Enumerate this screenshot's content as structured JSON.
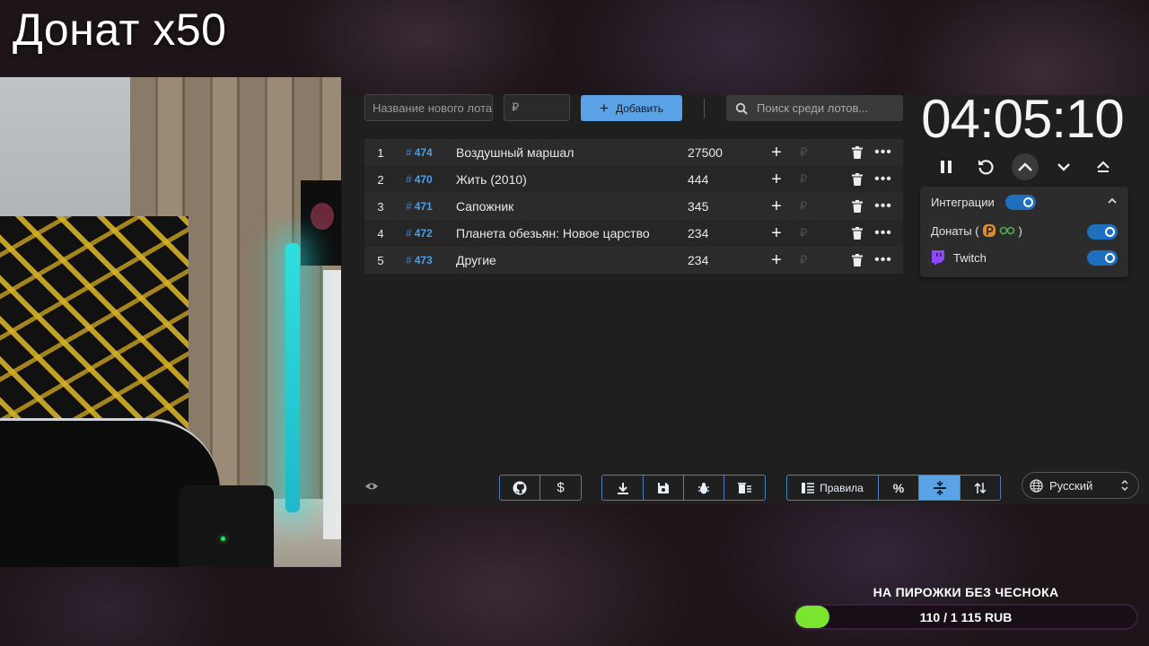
{
  "overlay": {
    "title": "Донат x50"
  },
  "toolbar": {
    "lot_name_placeholder": "Название нового лота",
    "price_placeholder": "₽",
    "add_label": "Добавить",
    "search_placeholder": "Поиск среди лотов..."
  },
  "lots": [
    {
      "index": "1",
      "id": "474",
      "name": "Воздушный маршал",
      "amount": "27500"
    },
    {
      "index": "2",
      "id": "470",
      "name": "Жить (2010)",
      "amount": "444"
    },
    {
      "index": "3",
      "id": "471",
      "name": "Сапожник",
      "amount": "345"
    },
    {
      "index": "4",
      "id": "472",
      "name": "Планета обезьян: Новое царство",
      "amount": "234"
    },
    {
      "index": "5",
      "id": "473",
      "name": "Другие",
      "amount": "234"
    }
  ],
  "lot_row": {
    "hash": "#",
    "rub": "₽",
    "more": "•••"
  },
  "timer": {
    "value": "04:05:10",
    "controls": [
      "pause-icon",
      "restart-icon",
      "speed-up-icon",
      "chevron-down-icon",
      "eject-icon"
    ]
  },
  "integrations": {
    "title": "Интеграции",
    "title_enabled": true,
    "donats_label": "Донаты (",
    "donats_close": ")",
    "donats_enabled": true,
    "twitch_label": "Twitch",
    "twitch_enabled": true
  },
  "bottom": {
    "rules_label": "Правила",
    "language": "Русский"
  },
  "goal": {
    "title": "НА ПИРОЖКИ БЕЗ ЧЕСНОКА",
    "progress_text": "110 / 1 115 RUB",
    "current": 110,
    "target": 1115,
    "fill_color": "#79e52f"
  },
  "colors": {
    "accent": "#5aa3e6",
    "lot_id": "#4c9ee8",
    "twitch": "#9146ff",
    "donatpay": "#e08a2c"
  }
}
